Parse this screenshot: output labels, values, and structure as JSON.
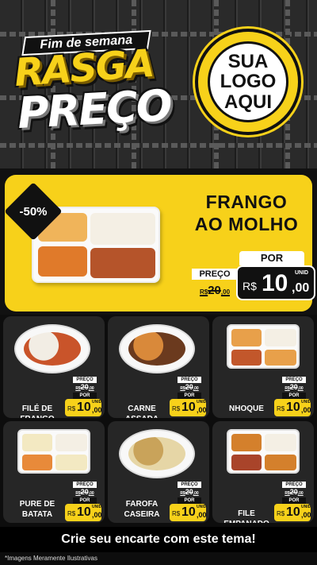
{
  "header": {
    "weekend_badge": "Fim de semana",
    "title_line1": "RASGA",
    "title_line2": "PREÇO",
    "logo_line1": "SUA",
    "logo_line2": "LOGO",
    "logo_line3": "AQUI"
  },
  "featured": {
    "discount": "-50%",
    "name_line1": "FRANGO",
    "name_line2": "AO MOLHO",
    "preco_label": "PREÇO",
    "old_prefix": "R$",
    "old_price": "20",
    "old_cents": ",00",
    "por_label": "POR",
    "currency": "R$",
    "new_int": "10",
    "new_cents": ",00",
    "unid": "UNID"
  },
  "products": [
    {
      "name_line1": "FILÉ DE FRANGO",
      "name_line2": "",
      "preco_label": "PREÇO",
      "old_prefix": "R$",
      "old_price": "20",
      "old_cents": ",00",
      "por_label": "POR",
      "currency": "R$",
      "new_int": "10",
      "new_cents": ",00",
      "unid": "UNID"
    },
    {
      "name_line1": "CARNE ASSADA",
      "name_line2": "",
      "preco_label": "PREÇO",
      "old_prefix": "R$",
      "old_price": "20",
      "old_cents": ",00",
      "por_label": "POR",
      "currency": "R$",
      "new_int": "10",
      "new_cents": ",00",
      "unid": "UNID"
    },
    {
      "name_line1": "NHOQUE",
      "name_line2": "",
      "preco_label": "PREÇO",
      "old_prefix": "R$",
      "old_price": "20",
      "old_cents": ",00",
      "por_label": "POR",
      "currency": "R$",
      "new_int": "10",
      "new_cents": ",00",
      "unid": "UNID"
    },
    {
      "name_line1": "PURE DE",
      "name_line2": "BATATA",
      "preco_label": "PREÇO",
      "old_prefix": "R$",
      "old_price": "20",
      "old_cents": ",00",
      "por_label": "POR",
      "currency": "R$",
      "new_int": "10",
      "new_cents": ",00",
      "unid": "UNID"
    },
    {
      "name_line1": "FAROFA",
      "name_line2": "CASEIRA",
      "preco_label": "PREÇO",
      "old_prefix": "R$",
      "old_price": "20",
      "old_cents": ",00",
      "por_label": "POR",
      "currency": "R$",
      "new_int": "10",
      "new_cents": ",00",
      "unid": "UNID"
    },
    {
      "name_line1": "FILE EMPANADO",
      "name_line2": "",
      "preco_label": "PREÇO",
      "old_prefix": "R$",
      "old_price": "20",
      "old_cents": ",00",
      "por_label": "POR",
      "currency": "R$",
      "new_int": "10",
      "new_cents": ",00",
      "unid": "UNID"
    }
  ],
  "footer": {
    "cta": "Crie seu encarte com este tema!",
    "disclaimer": "*Imagens Meramente Ilustrativas"
  },
  "colors": {
    "accent": "#f7d11a",
    "background": "#111111",
    "card": "#262626"
  }
}
